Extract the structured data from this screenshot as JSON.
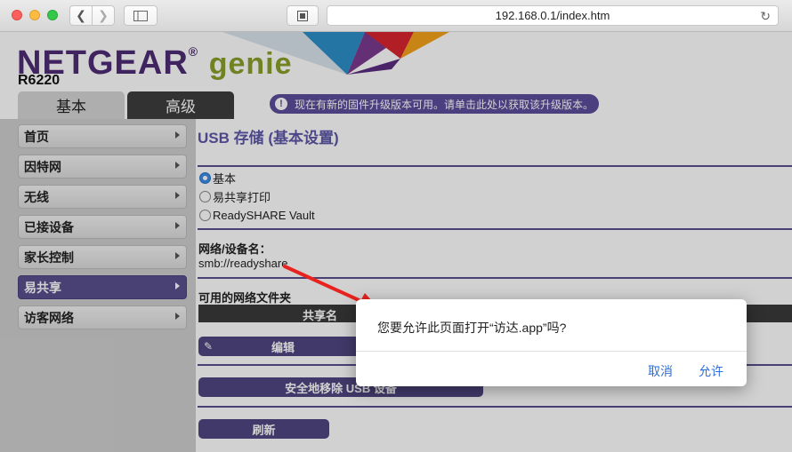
{
  "browser": {
    "url": "192.168.0.1/index.htm"
  },
  "header": {
    "logo_main": "NETGEAR",
    "logo_sub": "genie",
    "logo_reg": "®",
    "model": "R6220",
    "tabs": [
      {
        "label": "基本"
      },
      {
        "label": "高级"
      }
    ],
    "firmware_notice": "现在有新的固件升级版本可用。请单击此处以获取该升级版本。",
    "firmware_icon": "!"
  },
  "sidebar": {
    "items": [
      {
        "label": "首页"
      },
      {
        "label": "因特网"
      },
      {
        "label": "无线"
      },
      {
        "label": "已接设备"
      },
      {
        "label": "家长控制"
      },
      {
        "label": "易共享",
        "active": true
      },
      {
        "label": "访客网络"
      }
    ]
  },
  "content": {
    "title": "USB 存储 (基本设置)",
    "options": [
      {
        "label": "基本",
        "selected": true
      },
      {
        "label": "易共享打印",
        "selected": false
      },
      {
        "label": "ReadySHARE Vault",
        "selected": false
      }
    ],
    "device_name_label": "网络/设备名：",
    "device_name_value": "smb://readyshare",
    "folders_label": "可用的网络文件夹",
    "table_header": "共享名",
    "edit_button": "编辑",
    "remove_button": "安全地移除 USB 设备",
    "refresh_button": "刷新"
  },
  "dialog": {
    "message": "您要允许此页面打开“访达.app”吗?",
    "cancel": "取消",
    "allow": "允许"
  },
  "colors": {
    "accent": "#5a4f8e",
    "link": "#2f6fd9",
    "arrow": "#e8231f"
  }
}
